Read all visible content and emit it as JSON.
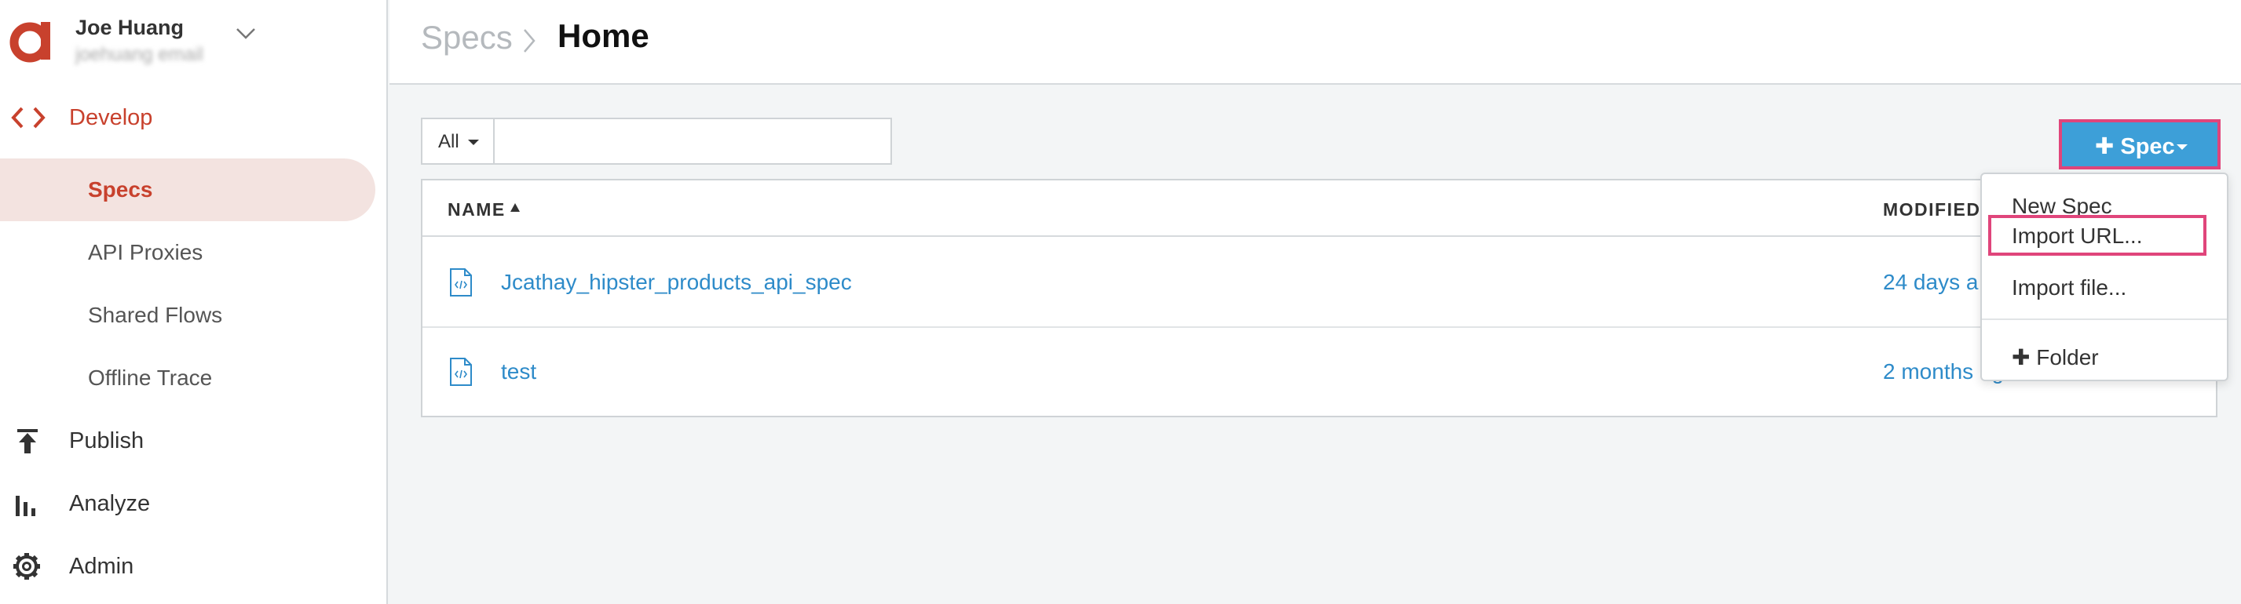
{
  "user": {
    "name": "Joe Huang",
    "email": "joehuang email"
  },
  "nav": {
    "develop": "Develop",
    "sub": [
      "Specs",
      "API Proxies",
      "Shared Flows",
      "Offline Trace"
    ],
    "publish": "Publish",
    "analyze": "Analyze",
    "admin": "Admin"
  },
  "breadcrumb": {
    "parent": "Specs",
    "current": "Home"
  },
  "filter": {
    "scope": "All",
    "query": ""
  },
  "table": {
    "columns": [
      "NAME",
      "MODIFIED"
    ],
    "rows": [
      {
        "name": "Jcathay_hipster_products_api_spec",
        "modified": "24 days a"
      },
      {
        "name": "test",
        "modified": "2 months ag"
      }
    ]
  },
  "spec_button": {
    "label": "Spec"
  },
  "menu": {
    "new_spec": "New Spec",
    "import_url": "Import URL...",
    "import_file": "Import file...",
    "folder": "Folder"
  },
  "colors": {
    "accent": "#c8412d",
    "primary": "#3d9fd8",
    "highlight": "#e0457b",
    "link": "#2e8bc9"
  }
}
